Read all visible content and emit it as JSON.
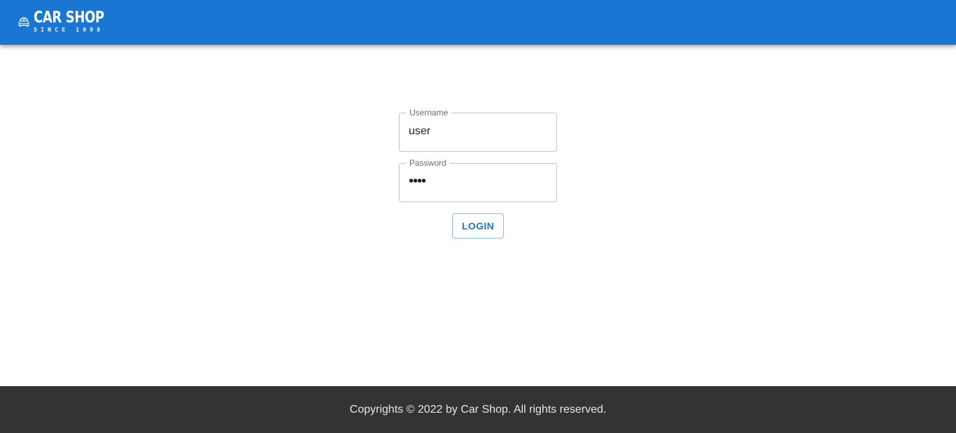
{
  "header": {
    "logo_title": "CAR SHOP",
    "logo_subtitle": "SINCE 1998",
    "logo_icon": "beetle-car-icon",
    "background_color": "#1976d2"
  },
  "login": {
    "username_label": "Username",
    "username_value": "user",
    "password_label": "Password",
    "password_value": "••••",
    "login_button": "LOGIN",
    "accent_color": "#1976d2"
  },
  "footer": {
    "text": "Copyrights © 2022 by Car Shop. All rights reserved.",
    "background_color": "#333333"
  }
}
